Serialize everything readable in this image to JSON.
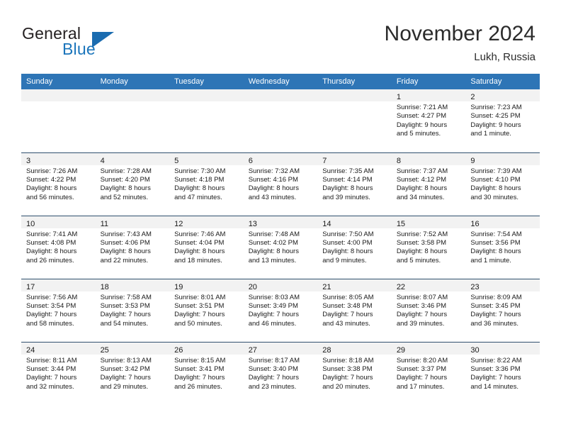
{
  "brand": {
    "word_one": "General",
    "word_two": "Blue",
    "accent_color": "#1b75bb"
  },
  "header": {
    "title": "November 2024",
    "location": "Lukh, Russia"
  },
  "theme": {
    "header_row_color": "#2e75b6",
    "daynum_band_color": "#f2f2f2",
    "row_divider_color": "#30506e"
  },
  "weekday_headers": [
    "Sunday",
    "Monday",
    "Tuesday",
    "Wednesday",
    "Thursday",
    "Friday",
    "Saturday"
  ],
  "weeks": [
    [
      {
        "day": "",
        "empty": true
      },
      {
        "day": "",
        "empty": true
      },
      {
        "day": "",
        "empty": true
      },
      {
        "day": "",
        "empty": true
      },
      {
        "day": "",
        "empty": true
      },
      {
        "day": "1",
        "sunrise": "Sunrise: 7:21 AM",
        "sunset": "Sunset: 4:27 PM",
        "daylight_line1": "Daylight: 9 hours",
        "daylight_line2": "and 5 minutes."
      },
      {
        "day": "2",
        "sunrise": "Sunrise: 7:23 AM",
        "sunset": "Sunset: 4:25 PM",
        "daylight_line1": "Daylight: 9 hours",
        "daylight_line2": "and 1 minute."
      }
    ],
    [
      {
        "day": "3",
        "sunrise": "Sunrise: 7:26 AM",
        "sunset": "Sunset: 4:22 PM",
        "daylight_line1": "Daylight: 8 hours",
        "daylight_line2": "and 56 minutes."
      },
      {
        "day": "4",
        "sunrise": "Sunrise: 7:28 AM",
        "sunset": "Sunset: 4:20 PM",
        "daylight_line1": "Daylight: 8 hours",
        "daylight_line2": "and 52 minutes."
      },
      {
        "day": "5",
        "sunrise": "Sunrise: 7:30 AM",
        "sunset": "Sunset: 4:18 PM",
        "daylight_line1": "Daylight: 8 hours",
        "daylight_line2": "and 47 minutes."
      },
      {
        "day": "6",
        "sunrise": "Sunrise: 7:32 AM",
        "sunset": "Sunset: 4:16 PM",
        "daylight_line1": "Daylight: 8 hours",
        "daylight_line2": "and 43 minutes."
      },
      {
        "day": "7",
        "sunrise": "Sunrise: 7:35 AM",
        "sunset": "Sunset: 4:14 PM",
        "daylight_line1": "Daylight: 8 hours",
        "daylight_line2": "and 39 minutes."
      },
      {
        "day": "8",
        "sunrise": "Sunrise: 7:37 AM",
        "sunset": "Sunset: 4:12 PM",
        "daylight_line1": "Daylight: 8 hours",
        "daylight_line2": "and 34 minutes."
      },
      {
        "day": "9",
        "sunrise": "Sunrise: 7:39 AM",
        "sunset": "Sunset: 4:10 PM",
        "daylight_line1": "Daylight: 8 hours",
        "daylight_line2": "and 30 minutes."
      }
    ],
    [
      {
        "day": "10",
        "sunrise": "Sunrise: 7:41 AM",
        "sunset": "Sunset: 4:08 PM",
        "daylight_line1": "Daylight: 8 hours",
        "daylight_line2": "and 26 minutes."
      },
      {
        "day": "11",
        "sunrise": "Sunrise: 7:43 AM",
        "sunset": "Sunset: 4:06 PM",
        "daylight_line1": "Daylight: 8 hours",
        "daylight_line2": "and 22 minutes."
      },
      {
        "day": "12",
        "sunrise": "Sunrise: 7:46 AM",
        "sunset": "Sunset: 4:04 PM",
        "daylight_line1": "Daylight: 8 hours",
        "daylight_line2": "and 18 minutes."
      },
      {
        "day": "13",
        "sunrise": "Sunrise: 7:48 AM",
        "sunset": "Sunset: 4:02 PM",
        "daylight_line1": "Daylight: 8 hours",
        "daylight_line2": "and 13 minutes."
      },
      {
        "day": "14",
        "sunrise": "Sunrise: 7:50 AM",
        "sunset": "Sunset: 4:00 PM",
        "daylight_line1": "Daylight: 8 hours",
        "daylight_line2": "and 9 minutes."
      },
      {
        "day": "15",
        "sunrise": "Sunrise: 7:52 AM",
        "sunset": "Sunset: 3:58 PM",
        "daylight_line1": "Daylight: 8 hours",
        "daylight_line2": "and 5 minutes."
      },
      {
        "day": "16",
        "sunrise": "Sunrise: 7:54 AM",
        "sunset": "Sunset: 3:56 PM",
        "daylight_line1": "Daylight: 8 hours",
        "daylight_line2": "and 1 minute."
      }
    ],
    [
      {
        "day": "17",
        "sunrise": "Sunrise: 7:56 AM",
        "sunset": "Sunset: 3:54 PM",
        "daylight_line1": "Daylight: 7 hours",
        "daylight_line2": "and 58 minutes."
      },
      {
        "day": "18",
        "sunrise": "Sunrise: 7:58 AM",
        "sunset": "Sunset: 3:53 PM",
        "daylight_line1": "Daylight: 7 hours",
        "daylight_line2": "and 54 minutes."
      },
      {
        "day": "19",
        "sunrise": "Sunrise: 8:01 AM",
        "sunset": "Sunset: 3:51 PM",
        "daylight_line1": "Daylight: 7 hours",
        "daylight_line2": "and 50 minutes."
      },
      {
        "day": "20",
        "sunrise": "Sunrise: 8:03 AM",
        "sunset": "Sunset: 3:49 PM",
        "daylight_line1": "Daylight: 7 hours",
        "daylight_line2": "and 46 minutes."
      },
      {
        "day": "21",
        "sunrise": "Sunrise: 8:05 AM",
        "sunset": "Sunset: 3:48 PM",
        "daylight_line1": "Daylight: 7 hours",
        "daylight_line2": "and 43 minutes."
      },
      {
        "day": "22",
        "sunrise": "Sunrise: 8:07 AM",
        "sunset": "Sunset: 3:46 PM",
        "daylight_line1": "Daylight: 7 hours",
        "daylight_line2": "and 39 minutes."
      },
      {
        "day": "23",
        "sunrise": "Sunrise: 8:09 AM",
        "sunset": "Sunset: 3:45 PM",
        "daylight_line1": "Daylight: 7 hours",
        "daylight_line2": "and 36 minutes."
      }
    ],
    [
      {
        "day": "24",
        "sunrise": "Sunrise: 8:11 AM",
        "sunset": "Sunset: 3:44 PM",
        "daylight_line1": "Daylight: 7 hours",
        "daylight_line2": "and 32 minutes."
      },
      {
        "day": "25",
        "sunrise": "Sunrise: 8:13 AM",
        "sunset": "Sunset: 3:42 PM",
        "daylight_line1": "Daylight: 7 hours",
        "daylight_line2": "and 29 minutes."
      },
      {
        "day": "26",
        "sunrise": "Sunrise: 8:15 AM",
        "sunset": "Sunset: 3:41 PM",
        "daylight_line1": "Daylight: 7 hours",
        "daylight_line2": "and 26 minutes."
      },
      {
        "day": "27",
        "sunrise": "Sunrise: 8:17 AM",
        "sunset": "Sunset: 3:40 PM",
        "daylight_line1": "Daylight: 7 hours",
        "daylight_line2": "and 23 minutes."
      },
      {
        "day": "28",
        "sunrise": "Sunrise: 8:18 AM",
        "sunset": "Sunset: 3:38 PM",
        "daylight_line1": "Daylight: 7 hours",
        "daylight_line2": "and 20 minutes."
      },
      {
        "day": "29",
        "sunrise": "Sunrise: 8:20 AM",
        "sunset": "Sunset: 3:37 PM",
        "daylight_line1": "Daylight: 7 hours",
        "daylight_line2": "and 17 minutes."
      },
      {
        "day": "30",
        "sunrise": "Sunrise: 8:22 AM",
        "sunset": "Sunset: 3:36 PM",
        "daylight_line1": "Daylight: 7 hours",
        "daylight_line2": "and 14 minutes."
      }
    ]
  ]
}
